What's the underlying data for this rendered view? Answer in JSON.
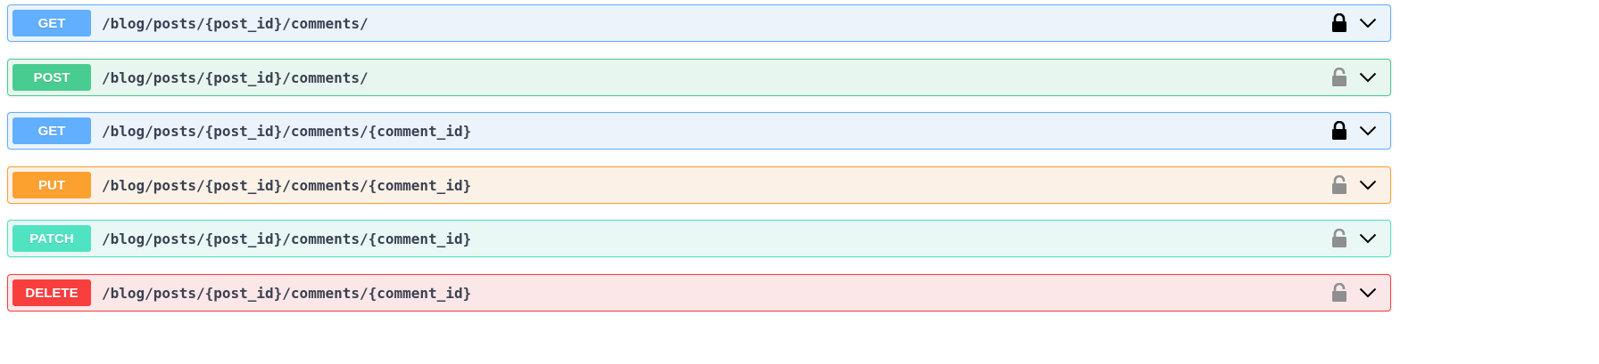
{
  "operations": [
    {
      "method": "GET",
      "path": "/blog/posts/{post_id}/comments/",
      "locked": true,
      "method_color": "#61affe"
    },
    {
      "method": "POST",
      "path": "/blog/posts/{post_id}/comments/",
      "locked": false,
      "method_color": "#49cc90"
    },
    {
      "method": "GET",
      "path": "/blog/posts/{post_id}/comments/{comment_id}",
      "locked": true,
      "method_color": "#61affe"
    },
    {
      "method": "PUT",
      "path": "/blog/posts/{post_id}/comments/{comment_id}",
      "locked": false,
      "method_color": "#fca130"
    },
    {
      "method": "PATCH",
      "path": "/blog/posts/{post_id}/comments/{comment_id}",
      "locked": false,
      "method_color": "#50e3c2"
    },
    {
      "method": "DELETE",
      "path": "/blog/posts/{post_id}/comments/{comment_id}",
      "locked": false,
      "method_color": "#f93e3e"
    }
  ],
  "icons": {
    "locked": "lock-closed-icon",
    "unlocked": "lock-open-icon",
    "expand": "chevron-down-icon"
  }
}
